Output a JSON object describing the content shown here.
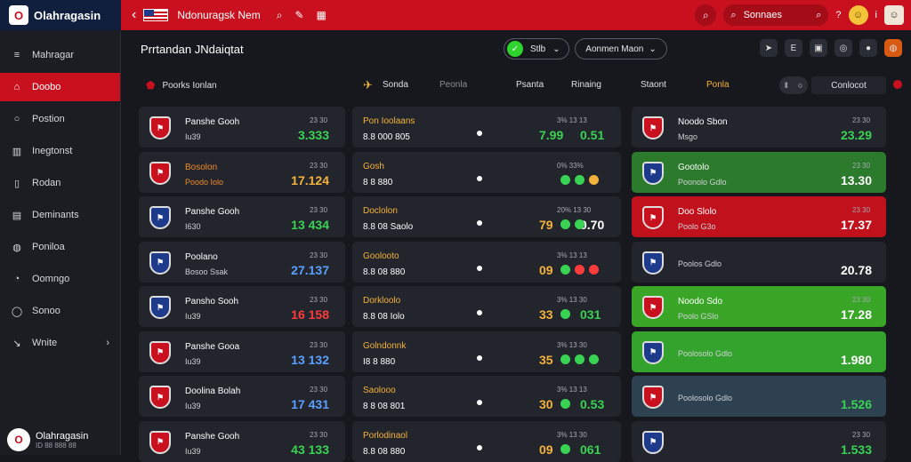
{
  "topbar": {
    "brand": "Olahragasin",
    "title": "Ndonuragsk Nem",
    "search_label": "Sonnaes"
  },
  "sidebar": {
    "items": [
      {
        "label": "Mahragar",
        "icon": "list-icon"
      },
      {
        "label": "Doobo",
        "icon": "home-icon"
      },
      {
        "label": "Postion",
        "icon": "circle-icon"
      },
      {
        "label": "Inegtonst",
        "icon": "building-icon"
      },
      {
        "label": "Rodan",
        "icon": "book-icon"
      },
      {
        "label": "Deminants",
        "icon": "document-icon"
      },
      {
        "label": "Poniloa",
        "icon": "ball-icon"
      },
      {
        "label": "Oomngo",
        "icon": "chat-icon"
      },
      {
        "label": "Sonoo",
        "icon": "shield-icon"
      },
      {
        "label": "Wnite",
        "icon": "arrow-icon"
      }
    ],
    "user": {
      "name": "Olahragasin",
      "sub": "ID 88 888 88"
    }
  },
  "main": {
    "title": "Prrtandan JNdaiqtat",
    "live_label": "Stlb",
    "mode_label": "Aonmen Maon"
  },
  "filters": {
    "section_label": "Poorks Ionlan",
    "tabs": [
      "Sonda",
      "Peonla",
      "Psanta",
      "Rinaing",
      "Staont",
      "Ponla"
    ],
    "combo_label": "Conlocot"
  },
  "col1": [
    {
      "team": "Panshe Gooh",
      "sub": "Iu39",
      "tiny": "23 30",
      "big": "3.333",
      "big_color": "g",
      "crest": "#c8101e"
    },
    {
      "team": "Bosolon",
      "sub": "Poodo Iolo",
      "tiny": "23 30",
      "big": "17.124",
      "big_color": "y",
      "crest": "#c8101e",
      "orange": true
    },
    {
      "team": "Panshe Gooh",
      "sub": "I630",
      "tiny": "23 30",
      "big": "13 434",
      "big_color": "g",
      "crest": "#1e3a8a"
    },
    {
      "team": "Poolano",
      "sub": "Bosoo Ssak",
      "tiny": "23 30",
      "big": "27.137",
      "big_color": "b",
      "crest": "#1e3a8a"
    },
    {
      "team": "Pansho Sooh",
      "sub": "Iu39",
      "tiny": "23 30",
      "big": "16 158",
      "big_color": "r",
      "crest": "#1e3a8a"
    },
    {
      "team": "Panshe Gooa",
      "sub": "Iu39",
      "tiny": "23 30",
      "big": "13 132",
      "big_color": "b",
      "crest": "#c8101e"
    },
    {
      "team": "Doolina Bolah",
      "sub": "Iu39",
      "tiny": "23 30",
      "big": "17 431",
      "big_color": "b",
      "crest": "#c8101e"
    },
    {
      "team": "Panshe Gooh",
      "sub": "Iu39",
      "tiny": "23 30",
      "big": "43 133",
      "big_color": "g",
      "crest": "#c8101e"
    }
  ],
  "col2": [
    {
      "title": "Pon Ioolaans",
      "line2": "8.8 000 805",
      "odds": "3% 13 13",
      "score1": "7.99",
      "score2": "0.51",
      "s1c": "g",
      "s2c": "g",
      "dots": []
    },
    {
      "title": "Gosh",
      "line2": "8 8 880",
      "odds": "0% 33%",
      "score1": "",
      "score2": "",
      "s1c": "g",
      "s2c": "g",
      "dots": [
        "#39d353",
        "#39d353",
        "#f5b23a"
      ]
    },
    {
      "title": "Doclolon",
      "line2": "8.8 08 Saolo",
      "odds": "20% 13 30",
      "score1": "79",
      "score2": "0.70",
      "s1c": "y",
      "s2c": "w",
      "dots": [
        "#39d353",
        "#39d353"
      ]
    },
    {
      "title": "Goolooto",
      "line2": "8.8 08 880",
      "odds": "3% 13 13",
      "score1": "09",
      "score2": "",
      "s1c": "y",
      "s2c": "w",
      "dots": [
        "#39d353",
        "#ff3b3b",
        "#ff3b3b"
      ]
    },
    {
      "title": "Dorkloolo",
      "line2": "8.8 08 Iolo",
      "odds": "3% 13 30",
      "score1": "33",
      "score2": "031",
      "s1c": "y",
      "s2c": "g",
      "dots": [
        "#39d353"
      ]
    },
    {
      "title": "Golndonnk",
      "line2": "I8 8 880",
      "odds": "3% 13 30",
      "score1": "35",
      "score2": "",
      "s1c": "y",
      "s2c": "g",
      "dots": [
        "#39d353",
        "#39d353",
        "#39d353"
      ]
    },
    {
      "title": "Saolooo",
      "line2": "8 8 08 801",
      "odds": "3% 13 13",
      "score1": "30",
      "score2": "0.53",
      "s1c": "y",
      "s2c": "g",
      "dots": [
        "#39d353"
      ]
    },
    {
      "title": "Porlodinaol",
      "line2": "8.8 08 880",
      "odds": "3% 13 30",
      "score1": "09",
      "score2": "061",
      "s1c": "y",
      "s2c": "g",
      "dots": [
        "#39d353"
      ]
    }
  ],
  "col3": [
    {
      "team": "Noodo Sbon",
      "sub": "Msgo",
      "tiny": "23 30",
      "big": "23.29",
      "cls": "",
      "big_color": "g"
    },
    {
      "team": "Gootolo",
      "sub": "Poonolo Gdlo",
      "tiny": "23 30",
      "big": "13.30",
      "cls": "green",
      "big_color": "w"
    },
    {
      "team": "Doo Slolo",
      "sub": "Poolo G3o",
      "tiny": "23 30",
      "big": "17.37",
      "cls": "red",
      "big_color": "w"
    },
    {
      "team": "",
      "sub": "Poolos Gdlo",
      "tiny": "",
      "big": "20.78",
      "cls": "",
      "big_color": "w"
    },
    {
      "team": "Noodo Sdo",
      "sub": "Poolo GSlo",
      "tiny": "23 30",
      "big": "17.28",
      "cls": "lime",
      "big_color": "w"
    },
    {
      "team": "",
      "sub": "Poolosolo Gdlo",
      "tiny": "",
      "big": "1.980",
      "cls": "brightgreen",
      "big_color": "w"
    },
    {
      "team": "",
      "sub": "Poolosolo Gdlo",
      "tiny": "",
      "big": "1.526",
      "cls": "slate",
      "big_color": "g"
    },
    {
      "team": "",
      "sub": "",
      "tiny": "23 30",
      "big": "1.533",
      "cls": "",
      "big_color": "g"
    }
  ]
}
